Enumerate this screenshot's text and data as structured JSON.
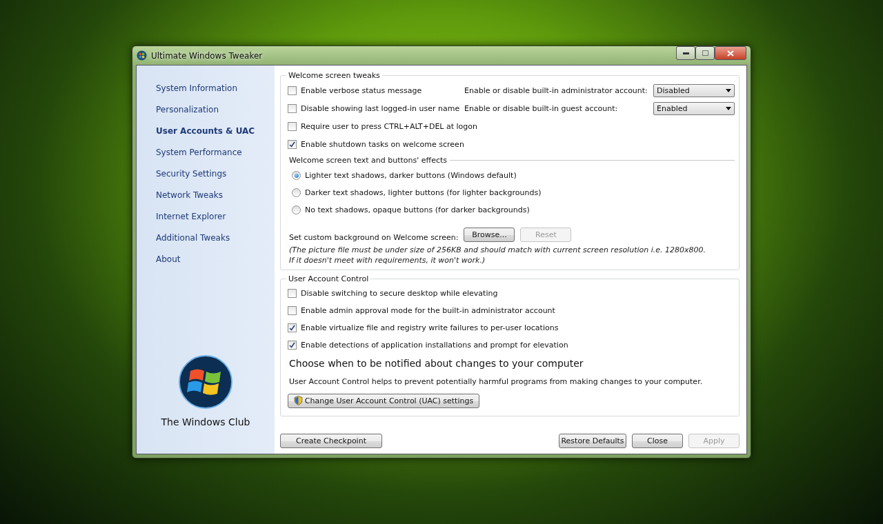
{
  "window": {
    "title": "Ultimate Windows Tweaker"
  },
  "sidebar": {
    "items": [
      {
        "label": "System Information",
        "selected": false
      },
      {
        "label": "Personalization",
        "selected": false
      },
      {
        "label": "User Accounts & UAC",
        "selected": true
      },
      {
        "label": "System Performance",
        "selected": false
      },
      {
        "label": "Security Settings",
        "selected": false
      },
      {
        "label": "Network Tweaks",
        "selected": false
      },
      {
        "label": "Internet Explorer",
        "selected": false
      },
      {
        "label": "Additional Tweaks",
        "selected": false
      },
      {
        "label": "About",
        "selected": false
      }
    ],
    "logo_caption": "The Windows Club"
  },
  "welcome_group": {
    "title": "Welcome screen tweaks",
    "checkboxes": [
      {
        "label": "Enable verbose status message",
        "checked": false
      },
      {
        "label": "Disable showing last logged-in user name",
        "checked": false
      },
      {
        "label": "Require user to press CTRL+ALT+DEL at logon",
        "checked": false
      },
      {
        "label": "Enable shutdown tasks on welcome screen",
        "checked": true
      }
    ],
    "dropdowns": [
      {
        "label": "Enable or disable built-in administrator account:",
        "value": "Disabled"
      },
      {
        "label": "Enable or disable built-in guest account:",
        "value": "Enabled"
      }
    ],
    "effects_title": "Welcome screen text and buttons' effects",
    "radios": [
      {
        "label": "Lighter text shadows, darker buttons (Windows default)",
        "selected": true
      },
      {
        "label": "Darker text shadows, lighter buttons (for lighter backgrounds)",
        "selected": false
      },
      {
        "label": "No text shadows, opaque buttons (for darker backgrounds)",
        "selected": false
      }
    ],
    "background_label": "Set custom background on Welcome screen:",
    "buttons": [
      {
        "label": "Browse...",
        "disabled": false
      },
      {
        "label": "Reset",
        "disabled": true
      }
    ],
    "note": [
      "(The picture file must be under size of 256KB and should match with current screen resolution i.e. 1280x800.",
      "If it doesn't meet with requirements, it won't work.)"
    ]
  },
  "uac_group": {
    "title": "User Account Control",
    "checkboxes": [
      {
        "label": "Disable switching to secure desktop while elevating",
        "checked": false
      },
      {
        "label": "Enable admin approval mode for the built-in administrator account",
        "checked": false
      },
      {
        "label": "Enable virtualize file and registry write failures to per-user locations",
        "checked": true
      },
      {
        "label": "Enable detections of application installations and prompt for elevation",
        "checked": true
      }
    ],
    "heading": "Choose when to be notified about changes to your computer",
    "description": "User Account Control helps to prevent potentially harmful programs from making changes to your computer.",
    "uac_button": "Change User Account Control (UAC) settings"
  },
  "footer": {
    "left_button": {
      "label": "Create Checkpoint",
      "disabled": false
    },
    "right_buttons": [
      {
        "label": "Restore Defaults",
        "disabled": false
      },
      {
        "label": "Close",
        "disabled": false
      },
      {
        "label": "Apply",
        "disabled": true
      }
    ]
  }
}
